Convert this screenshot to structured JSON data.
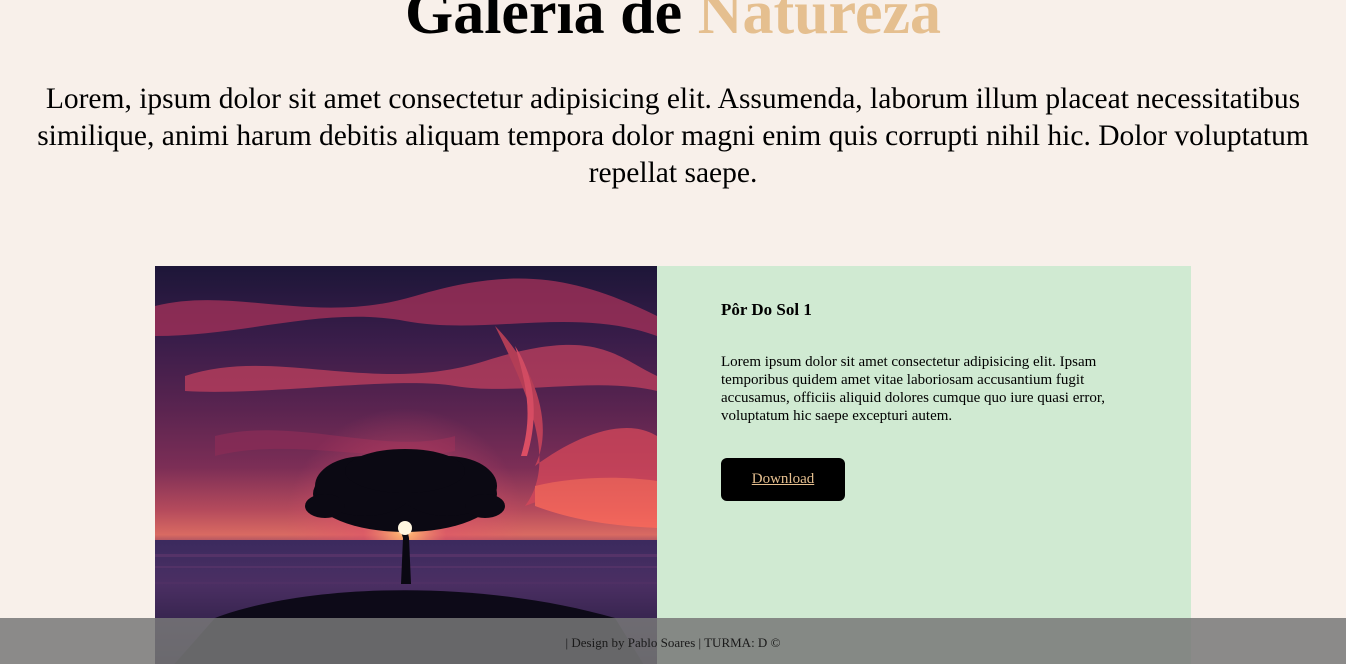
{
  "header": {
    "title_main": "Galeria de",
    "title_accent": "Natureza",
    "accent_color": "#e5bf8f"
  },
  "intro": {
    "text": "Lorem, ipsum dolor sit amet consectetur adipisicing elit. Assumenda, laborum illum placeat necessitatibus similique, animi harum debitis aliquam tempora dolor magni enim quis corrupti nihil hic. Dolor voluptatum repellat saepe."
  },
  "card": {
    "image_description": "sunset-tree-photo",
    "title": "Pôr Do Sol 1",
    "text": "Lorem ipsum dolor sit amet consectetur adipisicing elit. Ipsam temporibus quidem amet vitae laboriosam accusantium fugit accusamus, officiis aliquid dolores cumque quo iure quasi error, voluptatum hic saepe excepturi autem.",
    "button_label": "Download",
    "panel_color": "#d0ead2",
    "button_color": "#000000"
  },
  "footer": {
    "text": "| Design by Pablo Soares | TURMA: D ©"
  },
  "colors": {
    "background": "#f8f0ea"
  }
}
